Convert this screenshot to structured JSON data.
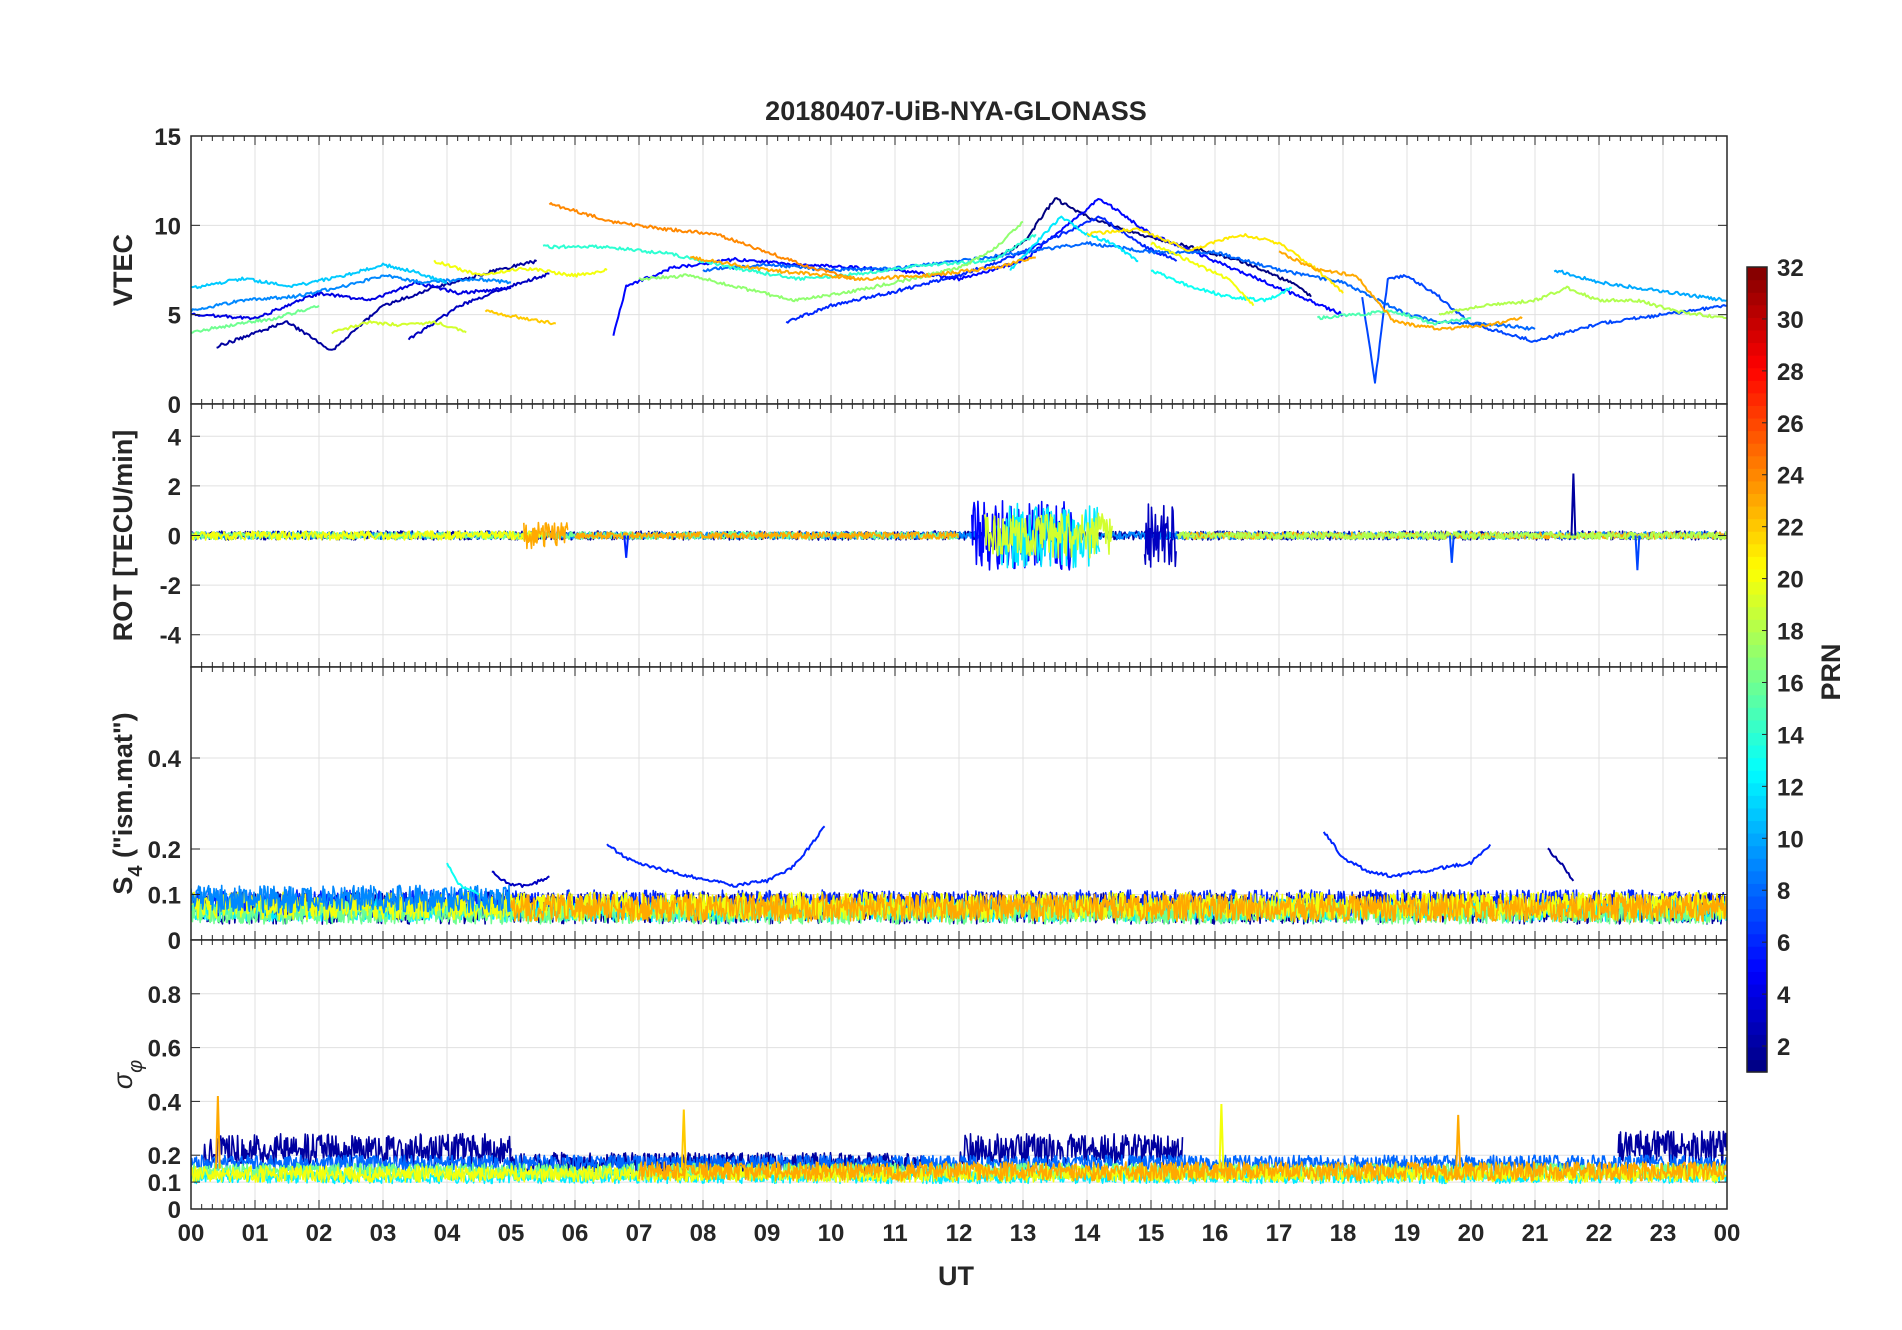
{
  "chart_data": {
    "type": "line",
    "title": "20180407-UiB-NYA-GLONASS",
    "xlabel": "UT",
    "x_tick_labels": [
      "00",
      "01",
      "02",
      "03",
      "04",
      "05",
      "06",
      "07",
      "08",
      "09",
      "10",
      "11",
      "12",
      "13",
      "14",
      "15",
      "16",
      "17",
      "18",
      "19",
      "20",
      "21",
      "22",
      "23",
      "00"
    ],
    "xlim": [
      0,
      24
    ],
    "grid": true,
    "colorbar": {
      "label": "PRN",
      "colormap": "jet",
      "clim": [
        1,
        32
      ],
      "ticks": [
        2,
        4,
        6,
        8,
        10,
        12,
        14,
        16,
        18,
        20,
        22,
        24,
        26,
        28,
        30,
        32
      ],
      "tick_labels": [
        "2",
        "4",
        "6",
        "8",
        "10",
        "12",
        "14",
        "16",
        "18",
        "20",
        "22",
        "24",
        "26",
        "28",
        "30",
        "32"
      ]
    },
    "panels": [
      {
        "id": "vtec",
        "ylabel": "VTEC",
        "ylim": [
          0,
          15
        ],
        "y_ticks": [
          0,
          5,
          10,
          15
        ],
        "y_tick_labels": [
          "0",
          "5",
          "10",
          "15"
        ],
        "series": [
          {
            "prn": 2,
            "x": [
              0.4,
              1.5,
              2.2,
              3.0,
              3.8,
              4.8,
              5.4
            ],
            "y": [
              3.2,
              4.6,
              3.0,
              5.5,
              6.5,
              7.5,
              8.0
            ]
          },
          {
            "prn": 3,
            "x": [
              3.4,
              4.2,
              5.0,
              5.6
            ],
            "y": [
              3.6,
              5.5,
              6.6,
              7.3
            ]
          },
          {
            "prn": 1,
            "x": [
              12.5,
              13.0,
              13.5,
              14.0,
              14.8,
              15.6,
              16.4,
              17.2,
              17.5
            ],
            "y": [
              8.0,
              9.0,
              11.5,
              10.5,
              9.5,
              8.8,
              8.0,
              6.8,
              6.0
            ]
          },
          {
            "prn": 4,
            "x": [
              0.0,
              1.0,
              2.0,
              2.8,
              3.5,
              4.2,
              5.0
            ],
            "y": [
              5.0,
              4.8,
              6.2,
              5.8,
              6.8,
              6.2,
              6.5
            ]
          },
          {
            "prn": 5,
            "x": [
              6.6,
              6.8,
              7.5,
              8.5,
              9.5,
              11.0,
              12.0,
              13.0,
              14.2,
              15.0,
              16.0,
              17.0,
              18.0
            ],
            "y": [
              3.8,
              6.6,
              7.6,
              8.1,
              7.8,
              7.5,
              7.0,
              8.0,
              11.5,
              9.5,
              8.0,
              6.5,
              5.0
            ]
          },
          {
            "prn": 6,
            "x": [
              9.3,
              10.0,
              11.0,
              12.0,
              12.8,
              13.6,
              14.2,
              14.8,
              15.4
            ],
            "y": [
              4.6,
              5.5,
              6.3,
              7.2,
              8.2,
              9.5,
              10.5,
              9.0,
              8.0
            ]
          },
          {
            "prn": 7,
            "x": [
              18.3,
              18.5,
              18.7,
              19.0,
              19.5,
              20.0,
              21.0,
              22.0,
              23.0,
              24.0
            ],
            "y": [
              6.0,
              1.2,
              7.0,
              7.2,
              6.0,
              4.5,
              3.5,
              4.5,
              5.0,
              5.5
            ]
          },
          {
            "prn": 8,
            "x": [
              8.0,
              9.0,
              10.0,
              11.0,
              12.0,
              13.0,
              14.0,
              15.0,
              16.0,
              17.0,
              18.0,
              19.0,
              19.5,
              20.5,
              21.0
            ],
            "y": [
              7.5,
              7.8,
              7.5,
              7.6,
              8.0,
              8.5,
              9.0,
              8.5,
              8.5,
              7.5,
              6.8,
              5.0,
              4.6,
              4.4,
              4.2
            ]
          },
          {
            "prn": 9,
            "x": [
              0.0,
              0.8,
              1.6,
              2.4,
              3.0,
              3.6,
              4.4,
              5.0
            ],
            "y": [
              5.2,
              5.8,
              6.0,
              6.6,
              7.2,
              6.8,
              7.0,
              6.8
            ]
          },
          {
            "prn": 10,
            "x": [
              21.3,
              22.0,
              22.6,
              23.2,
              24.0
            ],
            "y": [
              7.5,
              6.8,
              6.5,
              6.2,
              5.8
            ]
          },
          {
            "prn": 11,
            "x": [
              0.0,
              0.8,
              1.6,
              2.4,
              3.0,
              3.5,
              4.0
            ],
            "y": [
              6.5,
              7.0,
              6.6,
              7.2,
              7.8,
              7.4,
              6.8
            ]
          },
          {
            "prn": 12,
            "x": [
              12.8,
              13.2,
              13.6,
              14.0,
              14.4,
              14.8
            ],
            "y": [
              7.5,
              9.0,
              10.5,
              9.5,
              9.0,
              8.0
            ]
          },
          {
            "prn": 13,
            "x": [
              15.0,
              15.6,
              16.2,
              16.8,
              17.2
            ],
            "y": [
              7.5,
              6.6,
              6.0,
              5.8,
              6.5
            ]
          },
          {
            "prn": 14,
            "x": [
              5.5,
              6.5,
              7.5,
              8.5,
              9.5,
              10.5,
              11.5,
              12.5,
              13.2
            ],
            "y": [
              8.8,
              8.8,
              8.4,
              7.6,
              7.0,
              7.3,
              7.8,
              8.0,
              9.5
            ]
          },
          {
            "prn": 15,
            "x": [
              17.6,
              18.2,
              18.8,
              19.4,
              20.0
            ],
            "y": [
              4.8,
              5.0,
              5.2,
              4.5,
              4.8
            ]
          },
          {
            "prn": 16,
            "x": [
              0.0,
              0.6,
              1.3,
              2.0
            ],
            "y": [
              4.0,
              4.4,
              4.8,
              5.5
            ]
          },
          {
            "prn": 17,
            "x": [
              7.0,
              7.8,
              8.6,
              9.4,
              10.2,
              11.0,
              12.0,
              12.6,
              13.0
            ],
            "y": [
              7.0,
              7.2,
              6.5,
              5.8,
              6.2,
              6.8,
              7.6,
              8.8,
              10.2
            ]
          },
          {
            "prn": 18,
            "x": [
              19.5,
              20.2,
              21.0,
              21.5,
              22.0,
              22.6,
              23.2,
              24.0
            ],
            "y": [
              5.0,
              5.5,
              5.8,
              6.5,
              5.8,
              5.8,
              5.2,
              4.8
            ]
          },
          {
            "prn": 19,
            "x": [
              2.2,
              2.8,
              3.3,
              3.8,
              4.3
            ],
            "y": [
              4.0,
              4.6,
              4.4,
              4.6,
              4.0
            ]
          },
          {
            "prn": 20,
            "x": [
              3.8,
              4.5,
              5.2,
              6.0,
              6.5
            ],
            "y": [
              8.0,
              7.2,
              7.6,
              7.2,
              7.5
            ]
          },
          {
            "prn": 21,
            "x": [
              14.0,
              14.8,
              15.6,
              16.4,
              17.0,
              17.6,
              18.0
            ],
            "y": [
              9.5,
              9.8,
              8.6,
              9.5,
              9.0,
              7.5,
              6.2
            ]
          },
          {
            "prn": 20,
            "x": [
              15.0,
              15.6,
              16.2,
              16.6
            ],
            "y": [
              9.0,
              8.0,
              7.0,
              5.5
            ]
          },
          {
            "prn": 24,
            "x": [
              5.6,
              6.0,
              6.6,
              7.4,
              8.2,
              9.0,
              9.8,
              10.4
            ],
            "y": [
              11.2,
              10.8,
              10.2,
              9.8,
              9.5,
              8.5,
              7.5,
              7.0
            ]
          },
          {
            "prn": 23,
            "x": [
              7.8,
              9.0,
              10.5,
              11.5,
              12.5,
              13.2
            ],
            "y": [
              8.2,
              7.5,
              7.0,
              7.2,
              7.6,
              8.2
            ]
          },
          {
            "prn": 23,
            "x": [
              17.0,
              17.6,
              18.2,
              18.8,
              19.5,
              20.2,
              20.8
            ],
            "y": [
              8.5,
              7.5,
              7.2,
              4.6,
              4.2,
              4.4,
              4.8
            ]
          },
          {
            "prn": 22,
            "x": [
              4.6,
              5.2,
              5.7
            ],
            "y": [
              5.2,
              4.8,
              4.5
            ]
          }
        ]
      },
      {
        "id": "rot",
        "ylabel": "ROT [TECU/min]",
        "ylim": [
          -5.3,
          5.3
        ],
        "y_ticks": [
          -4,
          -2,
          0,
          2,
          4
        ],
        "y_tick_labels": [
          "-4",
          "-2",
          "0",
          "2",
          "4"
        ],
        "noise_bands": [
          {
            "prn": 2,
            "x0": 0.0,
            "x1": 24.0,
            "amp": 0.18
          },
          {
            "prn": 9,
            "x0": 0.0,
            "x1": 24.0,
            "amp": 0.15
          },
          {
            "prn": 16,
            "x0": 0.0,
            "x1": 12.0,
            "amp": 0.15
          },
          {
            "prn": 20,
            "x0": 0.0,
            "x1": 5.5,
            "amp": 0.18
          },
          {
            "prn": 23,
            "x0": 5.2,
            "x1": 5.9,
            "amp": 0.55
          },
          {
            "prn": 23,
            "x0": 6.0,
            "x1": 12.0,
            "amp": 0.14
          },
          {
            "prn": 23,
            "x0": 15.5,
            "x1": 24.0,
            "amp": 0.14
          },
          {
            "prn": 5,
            "x0": 12.2,
            "x1": 13.8,
            "amp": 1.4
          },
          {
            "prn": 12,
            "x0": 12.6,
            "x1": 14.2,
            "amp": 1.3
          },
          {
            "prn": 19,
            "x0": 12.4,
            "x1": 14.4,
            "amp": 0.9
          },
          {
            "prn": 3,
            "x0": 14.9,
            "x1": 15.4,
            "amp": 1.3
          },
          {
            "prn": 18,
            "x0": 15.4,
            "x1": 24.0,
            "amp": 0.15
          }
        ],
        "spikes": [
          {
            "prn": 2,
            "x": 21.6,
            "y": 2.5
          },
          {
            "prn": 7,
            "x": 22.6,
            "y": -1.4
          },
          {
            "prn": 7,
            "x": 19.7,
            "y": -1.1
          },
          {
            "prn": 6,
            "x": 6.8,
            "y": -0.9
          }
        ]
      },
      {
        "id": "s4",
        "ylabel": "S4 (\"ism.mat\")",
        "ylabel_main": "S",
        "ylabel_sub": "4",
        "ylabel_rest": " (\"ism.mat\")",
        "ylim": [
          0,
          0.6
        ],
        "y_ticks": [
          0,
          0.1,
          0.2,
          0.4
        ],
        "y_tick_labels": [
          "0",
          "0.1",
          "0.2",
          "0.4"
        ],
        "series": [
          {
            "prn": 6,
            "x": [
              6.5,
              6.8,
              7.2,
              7.8,
              8.5,
              9.0,
              9.4,
              9.7,
              9.9
            ],
            "y": [
              0.21,
              0.18,
              0.16,
              0.14,
              0.12,
              0.13,
              0.16,
              0.21,
              0.25
            ]
          },
          {
            "prn": 6,
            "x": [
              17.7,
              18.0,
              18.4,
              18.8,
              19.2,
              19.6,
              20.0,
              20.3
            ],
            "y": [
              0.24,
              0.18,
              0.15,
              0.14,
              0.15,
              0.16,
              0.17,
              0.21
            ]
          },
          {
            "prn": 2,
            "x": [
              21.2,
              21.4,
              21.6
            ],
            "y": [
              0.2,
              0.17,
              0.13
            ]
          },
          {
            "prn": 3,
            "x": [
              4.7,
              5.0,
              5.3,
              5.6
            ],
            "y": [
              0.15,
              0.12,
              0.12,
              0.14
            ]
          },
          {
            "prn": 13,
            "x": [
              4.0,
              4.2,
              4.5
            ],
            "y": [
              0.17,
              0.12,
              0.1
            ]
          }
        ],
        "noise_bands": [
          {
            "prn": 2,
            "x0": 0.0,
            "x1": 24.0,
            "base": 0.07,
            "amp": 0.035
          },
          {
            "prn": 6,
            "x0": 0.0,
            "x1": 24.0,
            "base": 0.08,
            "amp": 0.03
          },
          {
            "prn": 12,
            "x0": 0.0,
            "x1": 24.0,
            "base": 0.065,
            "amp": 0.025
          },
          {
            "prn": 16,
            "x0": 0.0,
            "x1": 24.0,
            "base": 0.06,
            "amp": 0.025
          },
          {
            "prn": 20,
            "x0": 0.0,
            "x1": 24.0,
            "base": 0.075,
            "amp": 0.03
          },
          {
            "prn": 23,
            "x0": 5.0,
            "x1": 24.0,
            "base": 0.07,
            "amp": 0.03
          },
          {
            "prn": 9,
            "x0": 0.0,
            "x1": 5.0,
            "base": 0.09,
            "amp": 0.03
          }
        ]
      },
      {
        "id": "sigma",
        "ylabel": "σφ",
        "ylabel_main": "σ",
        "ylabel_sub": "φ",
        "ylim": [
          0,
          1.0
        ],
        "y_ticks": [
          0,
          0.1,
          0.2,
          0.4,
          0.6,
          0.8
        ],
        "y_tick_labels": [
          "0",
          "0.1",
          "0.2",
          "0.4",
          "0.6",
          "0.8"
        ],
        "noise_bands": [
          {
            "prn": 2,
            "x0": 0.2,
            "x1": 5.0,
            "base": 0.22,
            "amp": 0.06
          },
          {
            "prn": 2,
            "x0": 5.0,
            "x1": 11.5,
            "base": 0.17,
            "amp": 0.04
          },
          {
            "prn": 2,
            "x0": 12.0,
            "x1": 15.5,
            "base": 0.22,
            "amp": 0.06
          },
          {
            "prn": 2,
            "x0": 22.3,
            "x1": 24.0,
            "base": 0.23,
            "amp": 0.06
          },
          {
            "prn": 8,
            "x0": 0.0,
            "x1": 24.0,
            "base": 0.17,
            "amp": 0.03
          },
          {
            "prn": 12,
            "x0": 0.0,
            "x1": 24.0,
            "base": 0.12,
            "amp": 0.025
          },
          {
            "prn": 16,
            "x0": 0.0,
            "x1": 24.0,
            "base": 0.14,
            "amp": 0.03
          },
          {
            "prn": 20,
            "x0": 0.0,
            "x1": 24.0,
            "base": 0.13,
            "amp": 0.03
          },
          {
            "prn": 23,
            "x0": 7.0,
            "x1": 24.0,
            "base": 0.14,
            "amp": 0.035
          }
        ],
        "spikes": [
          {
            "prn": 23,
            "x": 0.42,
            "y": 0.42
          },
          {
            "prn": 22,
            "x": 7.7,
            "y": 0.37
          },
          {
            "prn": 20,
            "x": 16.1,
            "y": 0.39
          },
          {
            "prn": 23,
            "x": 19.8,
            "y": 0.35
          }
        ]
      }
    ]
  }
}
